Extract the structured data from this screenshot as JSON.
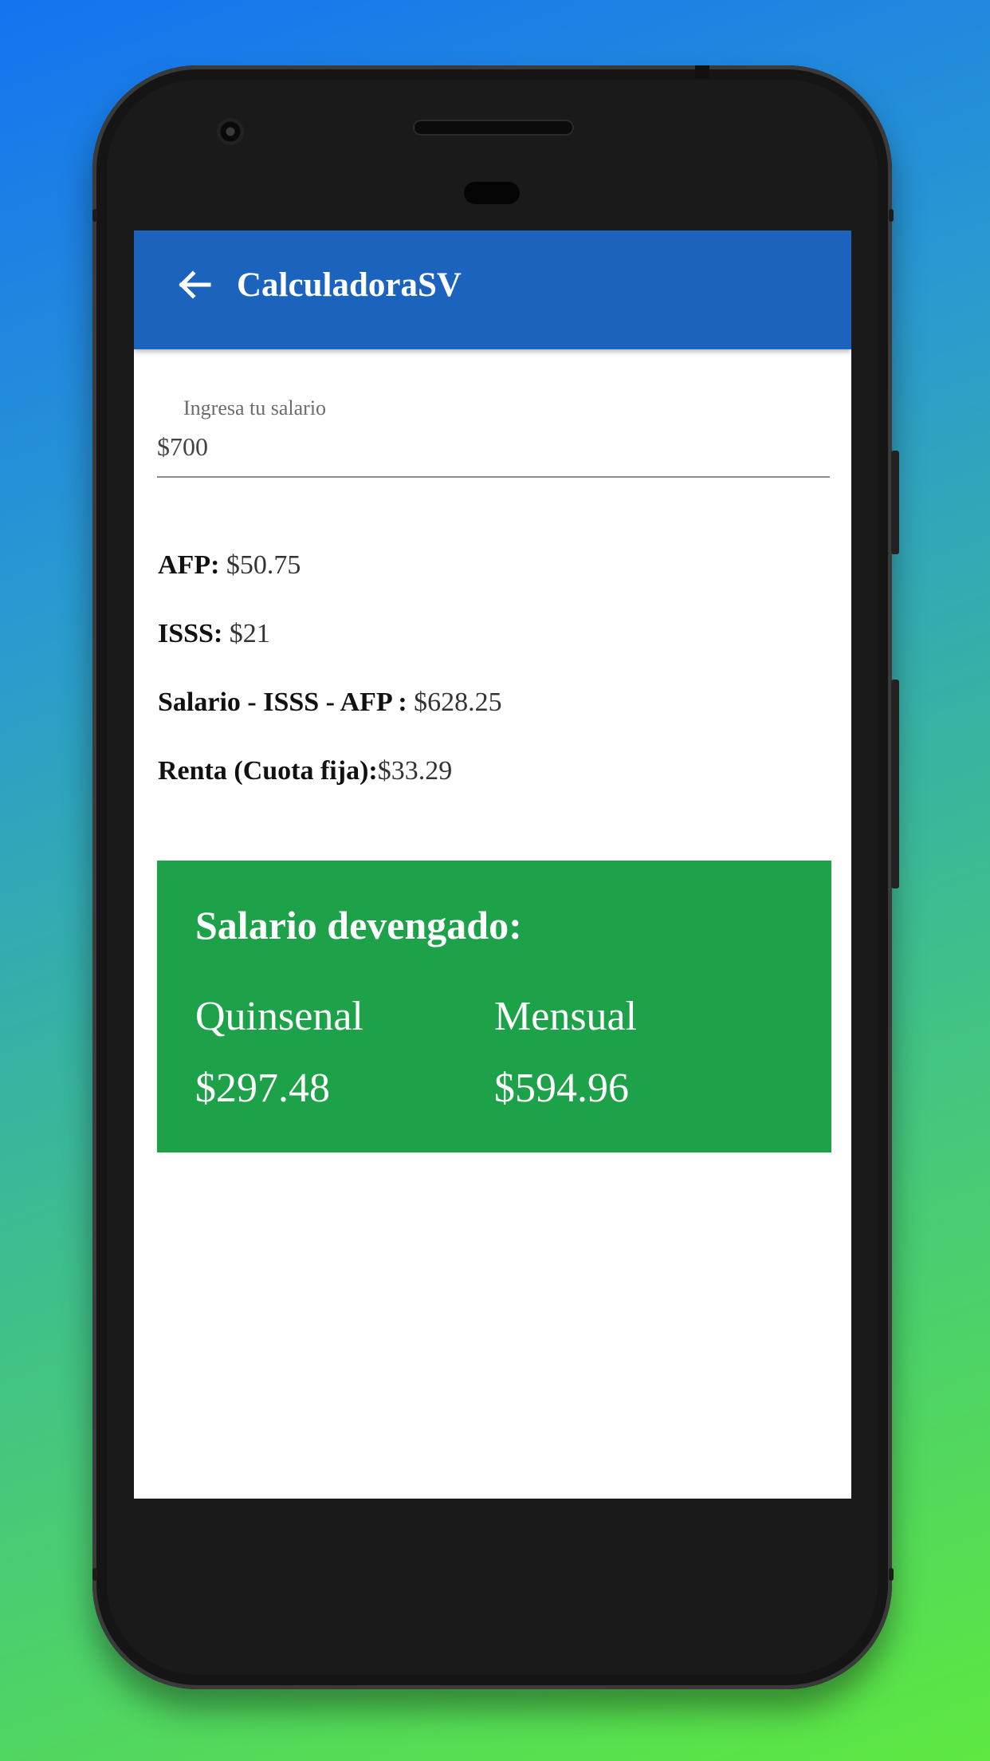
{
  "app_bar": {
    "title": "CalculadoraSV",
    "back_icon": "arrow-left-icon",
    "color": "#1c63be"
  },
  "salary_field": {
    "label": "Ingresa tu salario",
    "value": "$700"
  },
  "results": {
    "afp": {
      "label": "AFP:",
      "value": "$50.75"
    },
    "isss": {
      "label": "ISSS:",
      "value": "$21"
    },
    "neto": {
      "label": "Salario - ISSS - AFP :",
      "value": "$628.25"
    },
    "renta": {
      "label": "Renta (Cuota fija):",
      "value": "$33.29"
    }
  },
  "summary": {
    "title": "Salario devengado:",
    "quincenal_label": "Quinsenal",
    "quincenal_value": "$297.48",
    "mensual_label": "Mensual",
    "mensual_value": "$594.96",
    "color": "#1ea249"
  }
}
